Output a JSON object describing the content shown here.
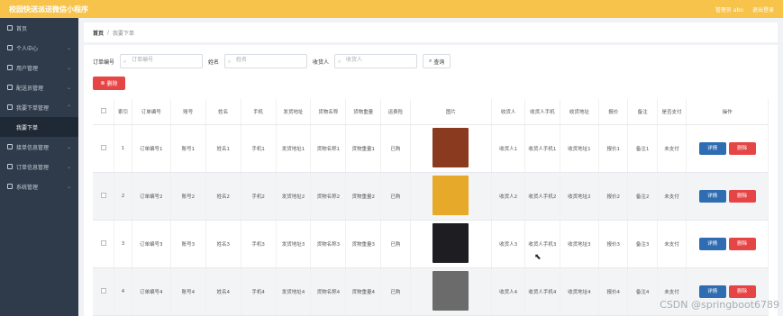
{
  "app": {
    "title": "校园快送派送微信小程序"
  },
  "topbar": {
    "user": "管理员 abo",
    "logout": "退出登录"
  },
  "sidebar": {
    "items": [
      {
        "label": "首页",
        "icon": "home-icon"
      },
      {
        "label": "个人中心",
        "icon": "user-icon"
      },
      {
        "label": "用户管理",
        "icon": "users-icon"
      },
      {
        "label": "配送员管理",
        "icon": "courier-icon"
      },
      {
        "label": "我要下单管理",
        "icon": "order-icon"
      },
      {
        "label": "我要下单",
        "icon": ""
      },
      {
        "label": "接单信息管理",
        "icon": "accept-icon"
      },
      {
        "label": "订单信息管理",
        "icon": "cart-icon"
      },
      {
        "label": "系统管理",
        "icon": "system-icon"
      }
    ]
  },
  "breadcrumb": {
    "home": "首页",
    "sep": "/",
    "current": "我要下单"
  },
  "search": {
    "order_label": "订单编号",
    "order_placeholder": "订单编号",
    "name_label": "姓名",
    "name_placeholder": "姓名",
    "receiver_label": "收货人",
    "receiver_placeholder": "收货人",
    "query_label": "查询"
  },
  "toolbar": {
    "delete_label": "删除"
  },
  "table": {
    "headers": [
      "索引",
      "订单编号",
      "账号",
      "姓名",
      "手机",
      "发货地址",
      "货物名称",
      "货物重量",
      "运费险",
      "图片",
      "收货人",
      "收货人手机",
      "收货地址",
      "报价",
      "备注",
      "是否支付",
      "操作"
    ],
    "detail_label": "详情",
    "delete_label": "删除",
    "rows": [
      {
        "index": "1",
        "order_no": "订单编号1",
        "account": "账号1",
        "name": "姓名1",
        "phone": "手机1",
        "ship_addr": "发货地址1",
        "goods": "货物名称1",
        "weight": "货物重量1",
        "insurance": "已购",
        "image_color": "#8a3b1f",
        "receiver": "收货人1",
        "receiver_phone": "收货人手机1",
        "recv_addr": "收货地址1",
        "quote": "报价1",
        "remark": "备注1",
        "paid": "未支付"
      },
      {
        "index": "2",
        "order_no": "订单编号2",
        "account": "账号2",
        "name": "姓名2",
        "phone": "手机2",
        "ship_addr": "发货地址2",
        "goods": "货物名称2",
        "weight": "货物重量2",
        "insurance": "已购",
        "image_color": "#e6a92a",
        "receiver": "收货人2",
        "receiver_phone": "收货人手机2",
        "recv_addr": "收货地址2",
        "quote": "报价2",
        "remark": "备注2",
        "paid": "未支付"
      },
      {
        "index": "3",
        "order_no": "订单编号3",
        "account": "账号3",
        "name": "姓名3",
        "phone": "手机3",
        "ship_addr": "发货地址3",
        "goods": "货物名称3",
        "weight": "货物重量3",
        "insurance": "已购",
        "image_color": "#1e1e22",
        "receiver": "收货人3",
        "receiver_phone": "收货人手机3",
        "recv_addr": "收货地址3",
        "quote": "报价3",
        "remark": "备注3",
        "paid": "未支付"
      },
      {
        "index": "4",
        "order_no": "订单编号4",
        "account": "账号4",
        "name": "姓名4",
        "phone": "手机4",
        "ship_addr": "发货地址4",
        "goods": "货物名称4",
        "weight": "货物重量4",
        "insurance": "已购",
        "image_color": "#6b6b6b",
        "receiver": "收货人4",
        "receiver_phone": "收货人手机4",
        "recv_addr": "收货地址4",
        "quote": "报价4",
        "remark": "备注4",
        "paid": "未支付"
      }
    ]
  },
  "watermark": "CSDN @springboot6789"
}
